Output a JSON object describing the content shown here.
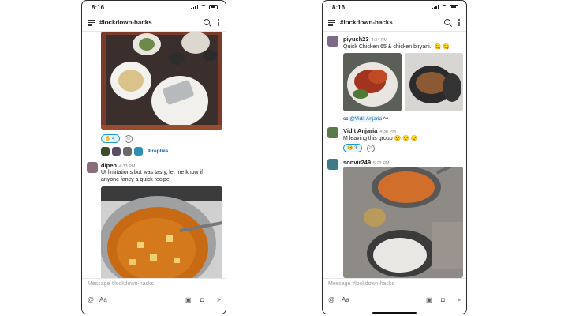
{
  "left_phone": {
    "time": "8:16",
    "channel": "#lockdown-hacks",
    "reactions": {
      "count": "4",
      "replies": "9 replies"
    },
    "message": {
      "author": "dipen",
      "time": "4:33 PM",
      "line1": "UI limitations but was tasty, let me know if",
      "line2": "anyone fancy a quick recipe."
    },
    "composer": {
      "placeholder": "Message #lockdown-hacks",
      "at": "@",
      "aa": "Aa"
    }
  },
  "right_phone": {
    "time": "8:16",
    "channel": "#lockdown-hacks",
    "msg1": {
      "author": "piyush23",
      "time": "4:34 PM",
      "text": "Quick Chicken 65 & chicken biryani.. 😋 😋"
    },
    "cc": {
      "prefix": "cc ",
      "mention": "@Vidit Anjaria",
      "suffix": " ^^"
    },
    "msg2": {
      "author": "Vidit Anjaria",
      "time": "4:38 PM",
      "text": "M leaving this group 😒 😒 😒",
      "reaction_emoji": "😆",
      "reaction_count": "3"
    },
    "msg3": {
      "author": "sonvir249",
      "time": "5:22 PM"
    },
    "composer": {
      "placeholder": "Message #lockdown-hacks",
      "at": "@",
      "aa": "Aa"
    }
  },
  "colors": {
    "mention": "#1264a3",
    "reaction_border": "#1d9bd1"
  },
  "icons": [
    "hamburger-icon",
    "search-icon",
    "kebab-icon",
    "at-icon",
    "send-icon",
    "camera-icon",
    "attach-icon",
    "add-reaction-icon"
  ]
}
